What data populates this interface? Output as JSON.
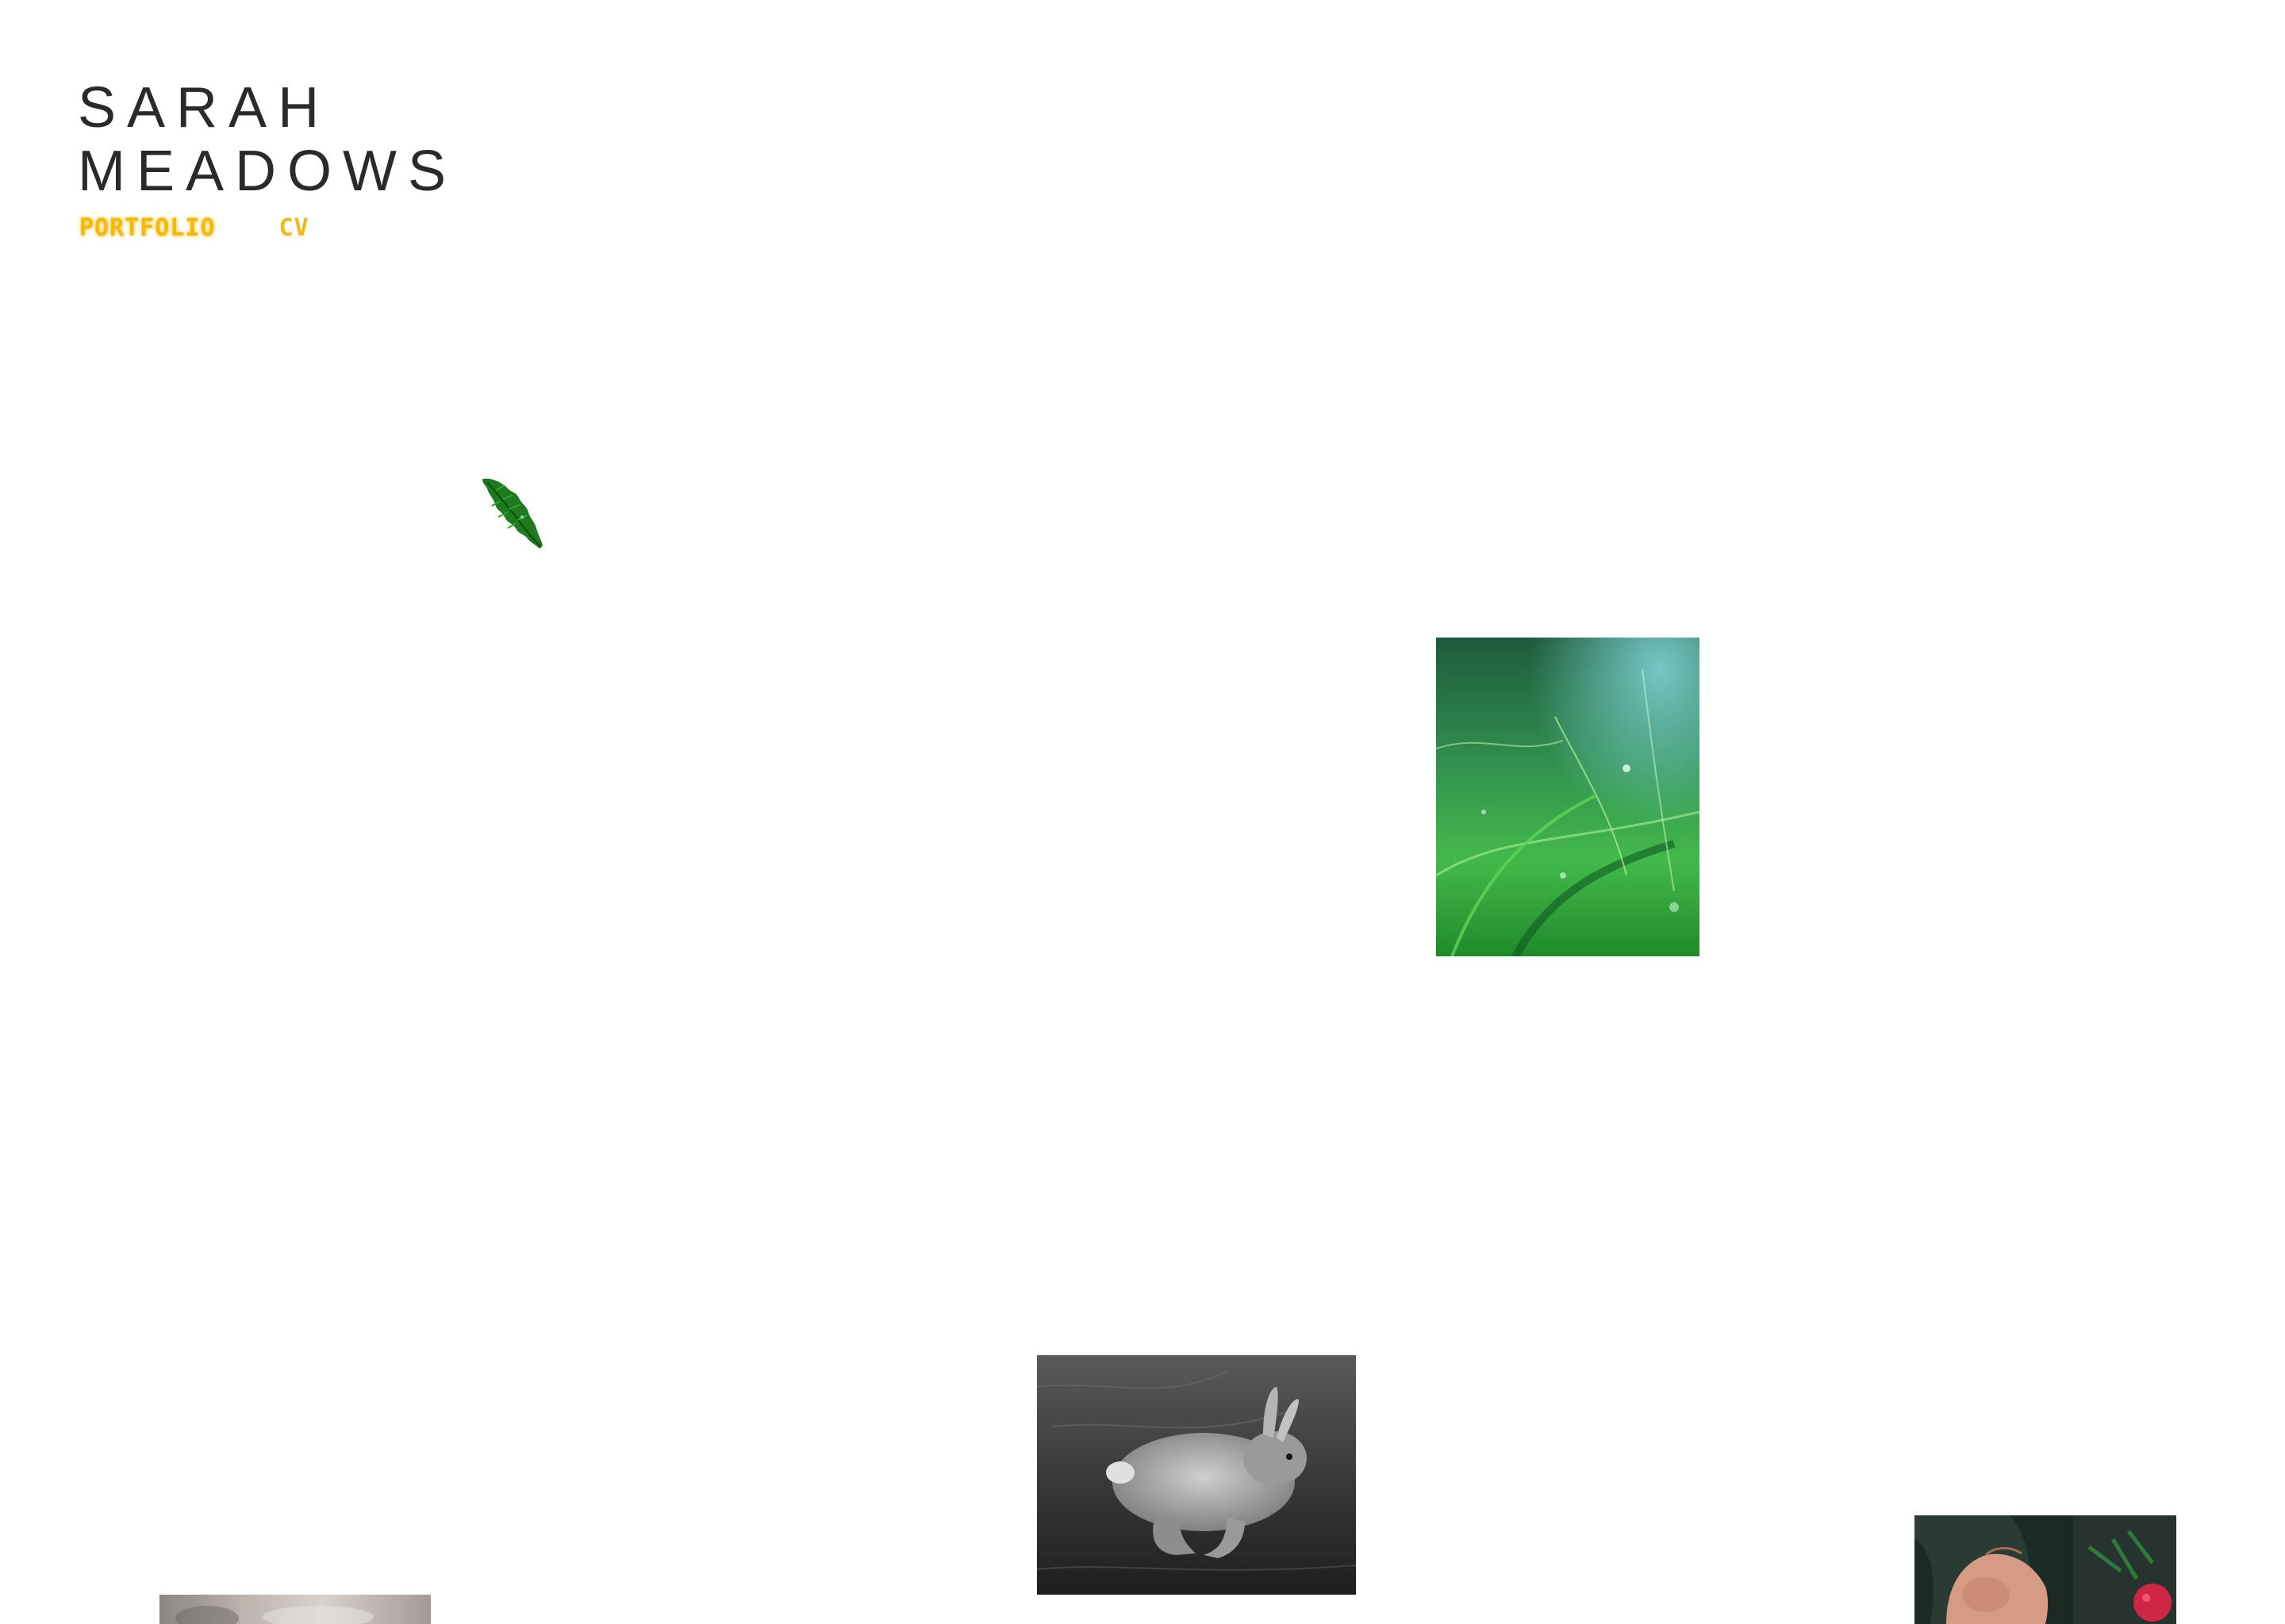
{
  "header": {
    "title_line1": "SARAH",
    "title_line2": "MEADOWS"
  },
  "nav": {
    "items": [
      {
        "label": "PORTFOLIO",
        "active": true
      },
      {
        "label": "CV",
        "active": false
      }
    ]
  },
  "colors": {
    "background": "#ffffff",
    "title": "#2a2a2a",
    "nav_link": "#f5b80f"
  },
  "gallery": {
    "images": [
      {
        "name": "leaf-cutout-photo"
      },
      {
        "name": "green-grass-photo"
      },
      {
        "name": "running-rabbit-photo"
      },
      {
        "name": "hand-with-berry-photo"
      },
      {
        "name": "blurred-portrait-photo"
      }
    ]
  }
}
